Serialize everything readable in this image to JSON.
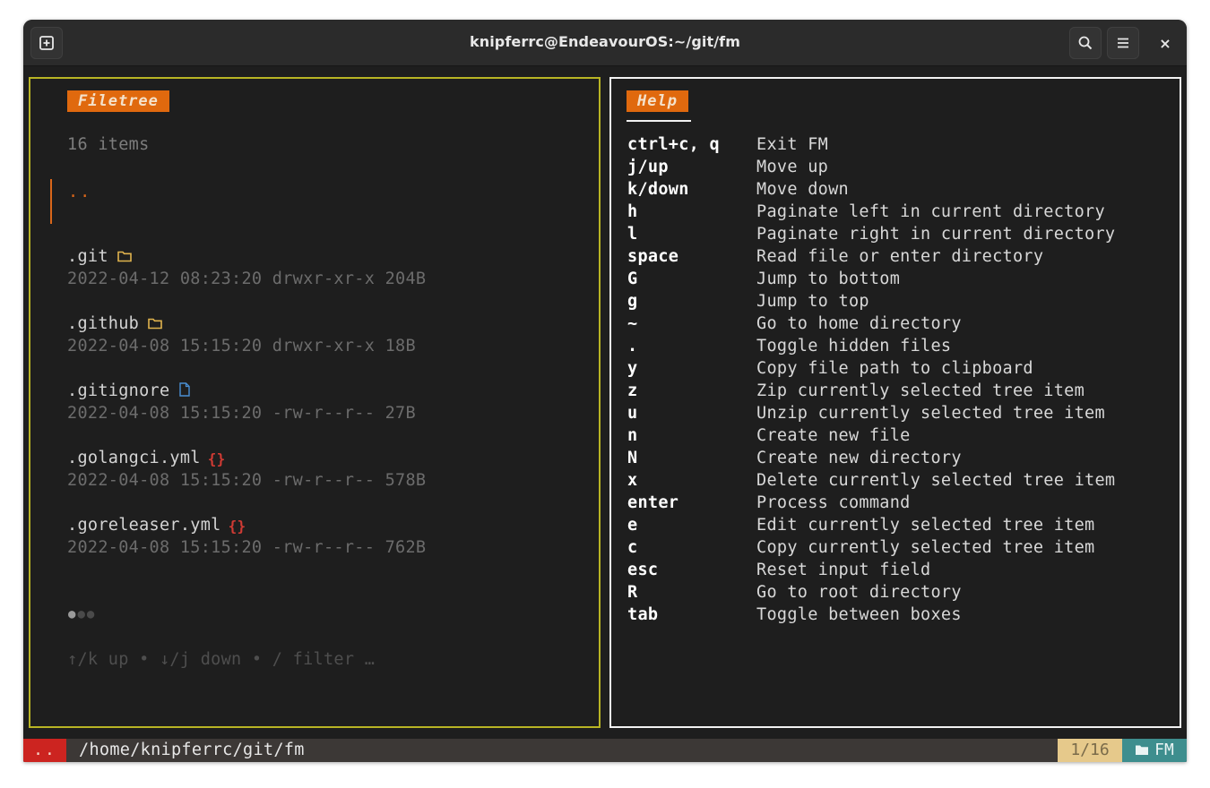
{
  "window": {
    "title": "knipferrc@EndeavourOS:~/git/fm",
    "close_label": "×"
  },
  "filetree": {
    "tag": "Filetree",
    "item_count": "16 items",
    "parent_entry": "..",
    "files": [
      {
        "name": ".git",
        "meta": "2022-04-12 08:23:20 drwxr-xr-x 204B",
        "icon": "folder-icon",
        "icon_color": "#e0b34d"
      },
      {
        "name": ".github",
        "meta": "2022-04-08 15:15:20 drwxr-xr-x 18B",
        "icon": "folder-icon",
        "icon_color": "#e0b34d"
      },
      {
        "name": ".gitignore",
        "meta": "2022-04-08 15:15:20 -rw-r--r-- 27B",
        "icon": "file-icon",
        "icon_color": "#4a8fd4"
      },
      {
        "name": ".golangci.yml",
        "meta": "2022-04-08 15:15:20 -rw-r--r-- 578B",
        "icon": "braces-icon",
        "icon_color": "#d13b34"
      },
      {
        "name": ".goreleaser.yml",
        "meta": "2022-04-08 15:15:20 -rw-r--r-- 762B",
        "icon": "braces-icon",
        "icon_color": "#d13b34"
      }
    ],
    "pager": {
      "current_page": 1,
      "total_pages": 3
    },
    "key_help": "↑/k up • ↓/j down • / filter …"
  },
  "help": {
    "tag": "Help",
    "rows": [
      {
        "key": "ctrl+c, q",
        "desc": "Exit FM"
      },
      {
        "key": "j/up",
        "desc": "Move up"
      },
      {
        "key": "k/down",
        "desc": "Move down"
      },
      {
        "key": "h",
        "desc": "Paginate left in current directory"
      },
      {
        "key": "l",
        "desc": "Paginate right in current directory"
      },
      {
        "key": "space",
        "desc": "Read file or enter directory"
      },
      {
        "key": "G",
        "desc": "Jump to bottom"
      },
      {
        "key": "g",
        "desc": "Jump to top"
      },
      {
        "key": "~",
        "desc": "Go to home directory"
      },
      {
        "key": ".",
        "desc": "Toggle hidden files"
      },
      {
        "key": "y",
        "desc": "Copy file path to clipboard"
      },
      {
        "key": "z",
        "desc": "Zip currently selected tree item"
      },
      {
        "key": "u",
        "desc": "Unzip currently selected tree item"
      },
      {
        "key": "n",
        "desc": "Create new file"
      },
      {
        "key": "N",
        "desc": "Create new directory"
      },
      {
        "key": "x",
        "desc": "Delete currently selected tree item"
      },
      {
        "key": "enter",
        "desc": "Process command"
      },
      {
        "key": "e",
        "desc": "Edit currently selected tree item"
      },
      {
        "key": "c",
        "desc": "Copy currently selected tree item"
      },
      {
        "key": "esc",
        "desc": "Reset input field"
      },
      {
        "key": "R",
        "desc": "Go to root directory"
      },
      {
        "key": "tab",
        "desc": "Toggle between boxes"
      }
    ]
  },
  "statusbar": {
    "left_label": "..",
    "path": "/home/knipferrc/git/fm",
    "count": "1/16",
    "mode_icon": "folder-icon",
    "mode_label": "FM"
  },
  "colors": {
    "accent_orange": "#e0690e",
    "active_border": "#b8b424",
    "inactive_border": "#f2f2f2",
    "status_red": "#cc2420",
    "status_yellow": "#e6c98b",
    "status_teal": "#3e8e8e"
  }
}
